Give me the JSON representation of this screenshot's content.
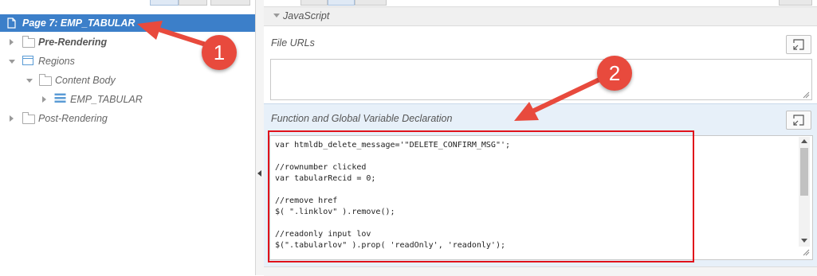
{
  "tree": {
    "selected_label": "Page 7: EMP_TABULAR",
    "items": [
      {
        "label": "Pre-Rendering"
      },
      {
        "label": "Regions"
      },
      {
        "label": "Content Body"
      },
      {
        "label": "EMP_TABULAR"
      },
      {
        "label": "Post-Rendering"
      }
    ]
  },
  "right": {
    "javascript_header": "JavaScript",
    "file_urls_label": "File URLs",
    "function_label": "Function and Global Variable Declaration",
    "code_lines": [
      "var htmldb_delete_message='\"DELETE_CONFIRM_MSG\"';",
      "",
      "//rownumber clicked",
      "var tabularRecid = 0;",
      "",
      "//remove href",
      "$( \".linklov\" ).remove();",
      "",
      "//readonly input lov",
      "$(\".tabularlov\" ).prop( 'readOnly', 'readonly');"
    ]
  },
  "annotations": {
    "badge1": "1",
    "badge2": "2"
  },
  "colors": {
    "selection": "#3c7fc9",
    "annotation": "#e84a3d",
    "highlight_box": "#e0121b",
    "function_header_bg": "#e7f0f9"
  }
}
